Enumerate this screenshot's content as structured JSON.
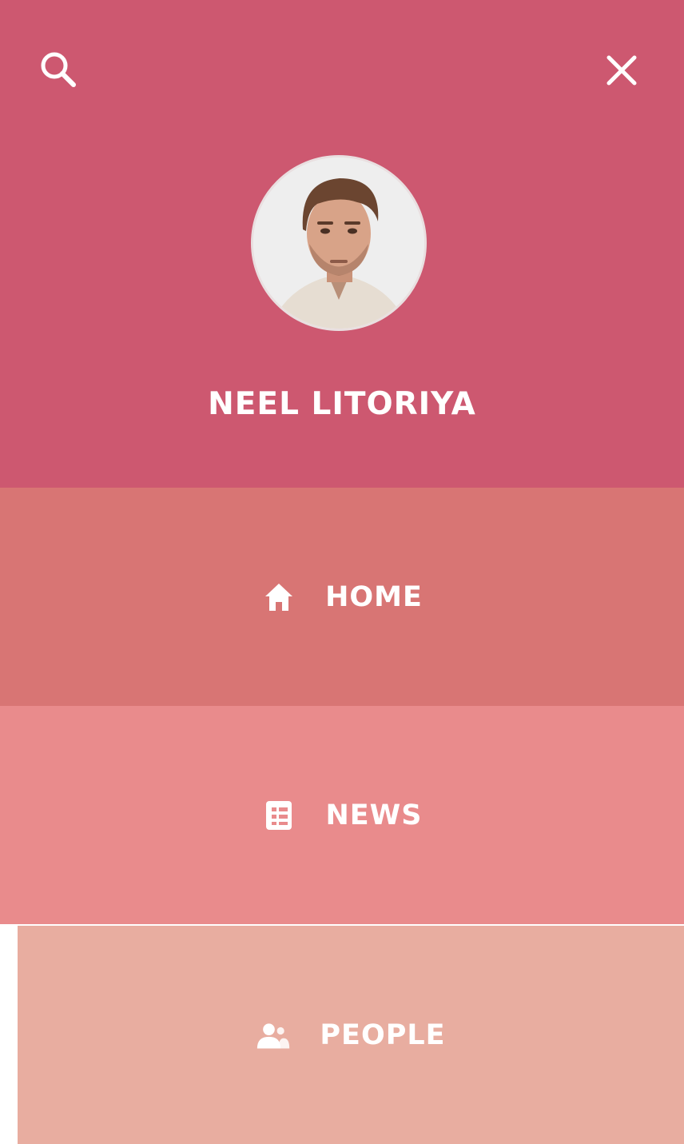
{
  "profile": {
    "name": "NEEL LITORIYA",
    "avatar_icon": "user-photo"
  },
  "header": {
    "search_icon": "search-icon",
    "close_icon": "close-icon"
  },
  "menu": {
    "items": [
      {
        "label": "HOME",
        "icon": "home-icon",
        "color": "#d87574"
      },
      {
        "label": "NEWS",
        "icon": "news-icon",
        "color": "#e98b8c"
      },
      {
        "label": "PEOPLE",
        "icon": "people-icon",
        "color": "#e8ada0",
        "active": true
      }
    ]
  },
  "colors": {
    "profile_bg": "#cd5870",
    "text": "#ffffff"
  }
}
